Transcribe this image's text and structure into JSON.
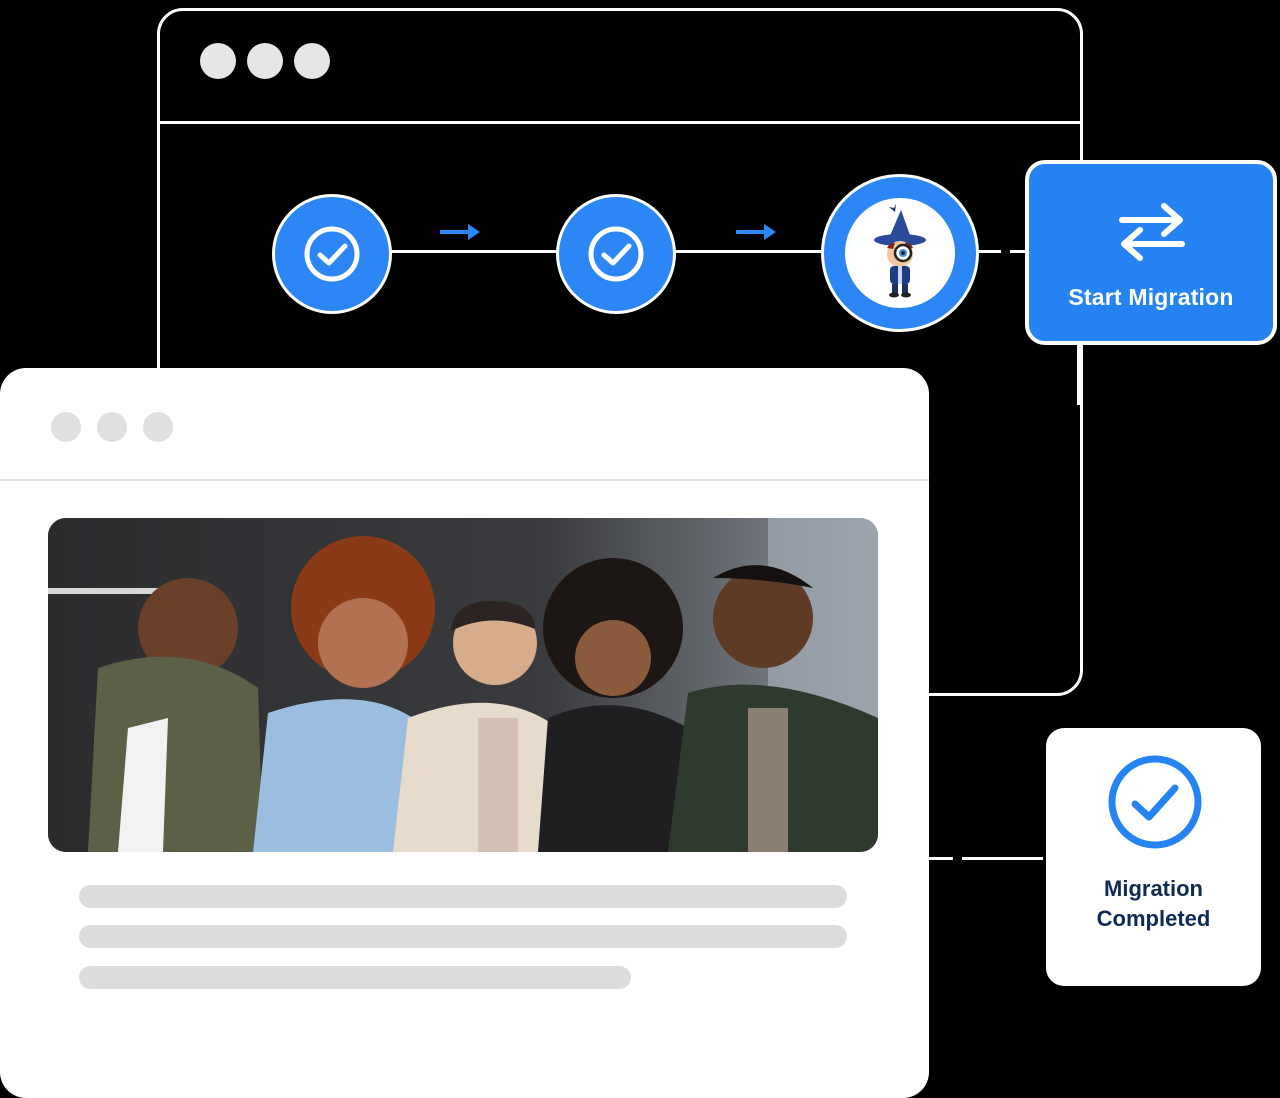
{
  "workflow": {
    "steps": [
      {
        "name": "step-1",
        "status": "completed",
        "icon": "check-icon"
      },
      {
        "name": "step-2",
        "status": "completed",
        "icon": "check-icon"
      },
      {
        "name": "step-3",
        "status": "active",
        "icon": "detective-mascot-icon"
      }
    ],
    "start_card": {
      "label": "Start Migration",
      "icon": "swap-arrows-icon"
    },
    "completed_card": {
      "line1": "Migration",
      "line2": "Completed",
      "icon": "check-circle-icon"
    }
  },
  "colors": {
    "accent": "#2583f4",
    "completed_text": "#0f2a55",
    "placeholder": "#dcdcdc",
    "background": "#000000"
  }
}
